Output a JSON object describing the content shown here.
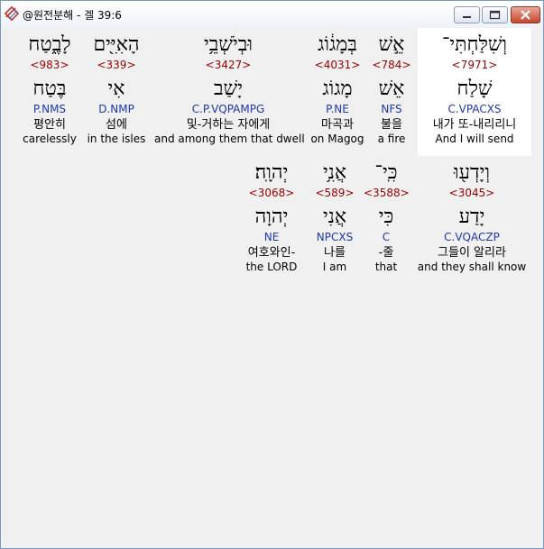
{
  "window": {
    "title": "@원전분해 - 겔 39:6"
  },
  "colors": {
    "strong": "#990000",
    "morph": "#1f37b0",
    "selected_bg": "#ffffff"
  },
  "words": [
    {
      "hebrew": "לָבֶ֑טַח",
      "strong": "<983>",
      "lemma": "בֶּטַח",
      "morph": "P.NMS",
      "korean": "평안히",
      "english": "carelessly"
    },
    {
      "hebrew": "הָאִיִּ֖ים",
      "strong": "<339>",
      "lemma": "אִי",
      "morph": "D.NMP",
      "korean": "섬에",
      "english": "in the isles"
    },
    {
      "hebrew": "וּבְיֹשְׁבֵ֥י",
      "strong": "<3427>",
      "lemma": "יָשַׁב",
      "morph": "C.P.VQPAMPG",
      "korean": "및-거하는 자에게",
      "english": "and among them that dwell"
    },
    {
      "hebrew": "בְּמָג֔וֹג",
      "strong": "<4031>",
      "lemma": "מָגוֹג",
      "morph": "P.NE",
      "korean": "마곡과",
      "english": "on Magog"
    },
    {
      "hebrew": "אֵ֣שׁ",
      "strong": "<784>",
      "lemma": "אֵשׁ",
      "morph": "NFS",
      "korean": "불을",
      "english": "a fire"
    },
    {
      "hebrew": "וְשִׁלַּחְתִּי־",
      "strong": "<7971>",
      "lemma": "שָׁלַח",
      "morph": "C.VPACXS",
      "korean": "내가 또-내리리니",
      "english": "And I will send"
    },
    {
      "hebrew": "יְהוָֽה׃",
      "strong": "<3068>",
      "lemma": "יְהוָה",
      "morph": "NE",
      "korean": "여호와인-",
      "english": "the LORD"
    },
    {
      "hebrew": "אֲנִ֥י",
      "strong": "<589>",
      "lemma": "אֲנִי",
      "morph": "NPCXS",
      "korean": "나를",
      "english": "I am"
    },
    {
      "hebrew": "כִּֽי־",
      "strong": "<3588>",
      "lemma": "כִּי",
      "morph": "C",
      "korean": "-줄",
      "english": "that"
    },
    {
      "hebrew": "וְיָדְע֖וּ",
      "strong": "<3045>",
      "lemma": "יָדַע",
      "morph": "C.VQACZP",
      "korean": "그들이 알리라",
      "english": "and they shall know"
    }
  ]
}
